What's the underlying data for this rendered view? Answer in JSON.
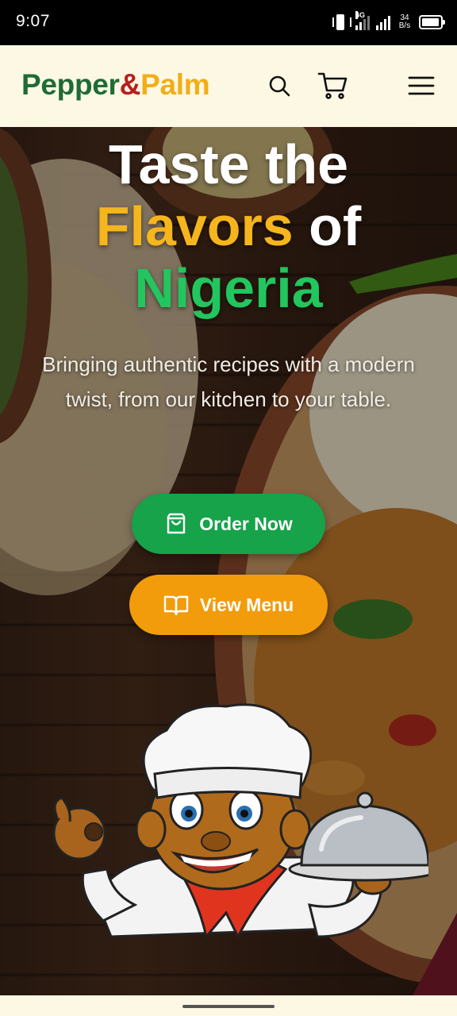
{
  "status_bar": {
    "time": "9:07",
    "network": "4G",
    "speed": "34 B/s",
    "icons": [
      "vibrate-icon",
      "signal-4g-icon",
      "signal-icon",
      "battery-icon"
    ],
    "battery_level": 0.95
  },
  "header": {
    "brand_part1": "Pepper",
    "brand_part2": "&",
    "brand_part3": "Palm",
    "icons": [
      "search-icon",
      "cart-icon",
      "menu-icon"
    ],
    "colors": {
      "brand_green": "#1f6b35",
      "brand_red": "#b81f1f",
      "brand_yellow": "#f2ae17",
      "background": "#fdf8e4"
    }
  },
  "hero": {
    "title_line1": "Taste the",
    "title_line2_highlight": "Flavors",
    "title_line2_rest": " of",
    "title_line3": "Nigeria",
    "subtitle": "Bringing authentic recipes with a modern twist, from our kitchen to your table.",
    "order_button": {
      "label": "Order Now",
      "icon": "shopping-bag-icon",
      "color": "#16a34a"
    },
    "menu_button": {
      "label": "View Menu",
      "icon": "open-book-icon",
      "color": "#f29c0c"
    },
    "illustration": "chef-mascot",
    "colors": {
      "highlight_yellow": "#f5b51d",
      "highlight_green": "#22c55e"
    }
  }
}
